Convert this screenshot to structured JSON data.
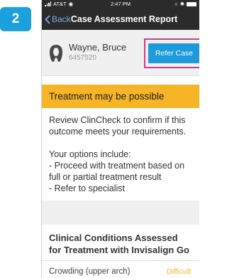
{
  "step_badge": "2",
  "status_bar": {
    "carrier": "AT&T",
    "time": "2:47 PM"
  },
  "nav": {
    "back_label": "Back",
    "title": "Case Assessment Report"
  },
  "patient": {
    "name": "Wayne, Bruce",
    "id": "6457520",
    "refer_button": "Refer Case"
  },
  "alert": {
    "text": "Treatment may be possible"
  },
  "body": {
    "intro": "Review ClinCheck to confirm if this outcome meets your requirements.",
    "options_heading": "Your options include:",
    "option1": "- Proceed with treatment based on full or partial treatment result",
    "option2": "- Refer to specialist"
  },
  "conditions": {
    "title": "Clinical Conditions Assessed for Treatment with Invisalign Go",
    "rows": [
      {
        "name": "Crowding (upper arch)",
        "status": "Difficult"
      }
    ]
  },
  "colors": {
    "accent": "#1d9ad9",
    "alert": "#f6b427",
    "highlight": "#c93d8a",
    "badge": "#1aa0dc"
  },
  "icons": {
    "back": "chevron-left-icon",
    "avatar": "tooth-icon"
  }
}
